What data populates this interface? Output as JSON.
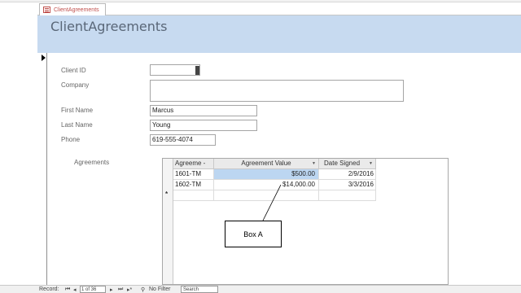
{
  "tab": {
    "label": "ClientAgreements",
    "icon": "form-icon"
  },
  "form": {
    "title": "ClientAgreements"
  },
  "fields": {
    "client_id": {
      "label": "Client ID",
      "value": ""
    },
    "company": {
      "label": "Company",
      "value": ""
    },
    "first_name": {
      "label": "First Name",
      "value": "Marcus"
    },
    "last_name": {
      "label": "Last Name",
      "value": "Young"
    },
    "phone": {
      "label": "Phone",
      "value": "619-555-4074"
    }
  },
  "subform": {
    "label": "Agreements",
    "columns": [
      "Agreeme -",
      "Agreement Value",
      "Date Signed"
    ],
    "rows": [
      {
        "id": "1601-TM",
        "value": "$500.00",
        "date": "2/9/2016"
      },
      {
        "id": "1602-TM",
        "value": "$14,000.00",
        "date": "3/3/2016"
      }
    ],
    "new_row_marker": "*"
  },
  "annotation": {
    "label": "Box A"
  },
  "status_bar": {
    "record_label": "Record:",
    "record_value": "1 of 36",
    "filter_label": "No Filter",
    "search_label": "Search"
  },
  "colors": {
    "header_band": "#c7daf0",
    "selected_cell": "#bcd6f1",
    "tab_accent": "#c0504d"
  }
}
